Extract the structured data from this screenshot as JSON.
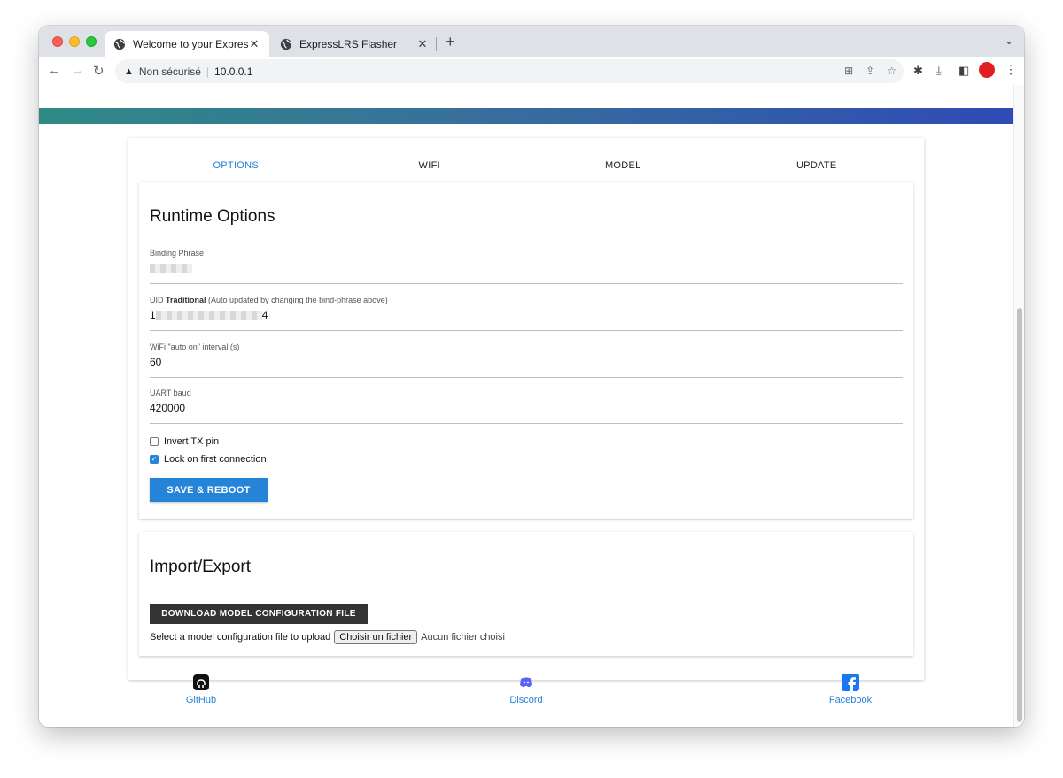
{
  "browser": {
    "tabs": [
      {
        "title": "Welcome to your ExpressLRS S",
        "active": true
      },
      {
        "title": "ExpressLRS Flasher",
        "active": false
      }
    ],
    "address": {
      "security_label": "Non sécurisé",
      "url": "10.0.0.1"
    }
  },
  "page": {
    "tabs": [
      "OPTIONS",
      "WIFI",
      "MODEL",
      "UPDATE"
    ],
    "active_tab": "OPTIONS",
    "runtime": {
      "title": "Runtime Options",
      "binding_phrase_label": "Binding Phrase",
      "uid_label_prefix": "UID",
      "uid_label_bold": "Traditional",
      "uid_label_suffix": "(Auto updated by changing the bind-phrase above)",
      "uid_value_start": "1",
      "uid_value_end": "4",
      "wifi_label": "WiFi \"auto on\" interval (s)",
      "wifi_value": "60",
      "uart_label": "UART baud",
      "uart_value": "420000",
      "invert_tx_label": "Invert TX pin",
      "invert_tx_checked": false,
      "lock_label": "Lock on first connection",
      "lock_checked": true,
      "save_label": "SAVE & REBOOT"
    },
    "import_export": {
      "title": "Import/Export",
      "download_label": "DOWNLOAD MODEL CONFIGURATION FILE",
      "upload_prompt": "Select a model configuration file to upload",
      "file_button_label": "Choisir un fichier",
      "no_file_label": "Aucun fichier choisi"
    },
    "footer": {
      "github": "GitHub",
      "discord": "Discord",
      "facebook": "Facebook"
    }
  },
  "colors": {
    "accent": "#2684d8",
    "dark_button": "#333333",
    "facebook": "#1877f2",
    "discord": "#5865f2"
  }
}
